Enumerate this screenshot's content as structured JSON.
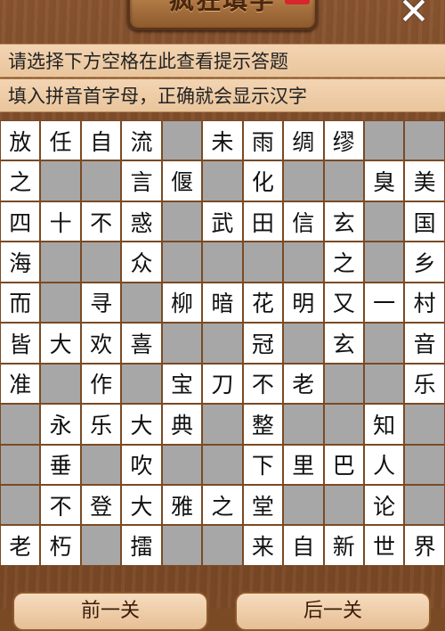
{
  "header": {
    "title": "疯狂填字",
    "close_symbol": "✕"
  },
  "hints": {
    "line1": "请选择下方空格在此查看提示答题",
    "line2": "填入拼音首字母，正确就会显示汉字"
  },
  "grid": [
    [
      {
        "c": "放",
        "t": "f"
      },
      {
        "c": "任",
        "t": "f"
      },
      {
        "c": "自",
        "t": "f"
      },
      {
        "c": "流",
        "t": "f"
      },
      {
        "c": "",
        "t": "e"
      },
      {
        "c": "未",
        "t": "f"
      },
      {
        "c": "雨",
        "t": "f"
      },
      {
        "c": "绸",
        "t": "f"
      },
      {
        "c": "缪",
        "t": "f"
      },
      {
        "c": "",
        "t": "e"
      },
      {
        "c": "",
        "t": "e"
      }
    ],
    [
      {
        "c": "之",
        "t": "f"
      },
      {
        "c": "",
        "t": "e"
      },
      {
        "c": "",
        "t": "e"
      },
      {
        "c": "言",
        "t": "f"
      },
      {
        "c": "偃",
        "t": "f"
      },
      {
        "c": "",
        "t": "e"
      },
      {
        "c": "化",
        "t": "f"
      },
      {
        "c": "",
        "t": "e"
      },
      {
        "c": "",
        "t": "e"
      },
      {
        "c": "臭",
        "t": "f"
      },
      {
        "c": "美",
        "t": "f"
      }
    ],
    [
      {
        "c": "四",
        "t": "f"
      },
      {
        "c": "十",
        "t": "f"
      },
      {
        "c": "不",
        "t": "f"
      },
      {
        "c": "惑",
        "t": "f"
      },
      {
        "c": "",
        "t": "e"
      },
      {
        "c": "武",
        "t": "f"
      },
      {
        "c": "田",
        "t": "f"
      },
      {
        "c": "信",
        "t": "f"
      },
      {
        "c": "玄",
        "t": "f"
      },
      {
        "c": "",
        "t": "e"
      },
      {
        "c": "国",
        "t": "f"
      }
    ],
    [
      {
        "c": "海",
        "t": "f"
      },
      {
        "c": "",
        "t": "e"
      },
      {
        "c": "",
        "t": "e"
      },
      {
        "c": "众",
        "t": "f"
      },
      {
        "c": "",
        "t": "e"
      },
      {
        "c": "",
        "t": "e"
      },
      {
        "c": "",
        "t": "e"
      },
      {
        "c": "",
        "t": "e"
      },
      {
        "c": "之",
        "t": "f"
      },
      {
        "c": "",
        "t": "e"
      },
      {
        "c": "乡",
        "t": "f"
      }
    ],
    [
      {
        "c": "而",
        "t": "f"
      },
      {
        "c": "",
        "t": "e"
      },
      {
        "c": "寻",
        "t": "f"
      },
      {
        "c": "",
        "t": "e"
      },
      {
        "c": "柳",
        "t": "f"
      },
      {
        "c": "暗",
        "t": "f"
      },
      {
        "c": "花",
        "t": "f"
      },
      {
        "c": "明",
        "t": "f"
      },
      {
        "c": "又",
        "t": "f"
      },
      {
        "c": "一",
        "t": "f"
      },
      {
        "c": "村",
        "t": "f"
      }
    ],
    [
      {
        "c": "皆",
        "t": "f"
      },
      {
        "c": "大",
        "t": "f"
      },
      {
        "c": "欢",
        "t": "f"
      },
      {
        "c": "喜",
        "t": "f"
      },
      {
        "c": "",
        "t": "e"
      },
      {
        "c": "",
        "t": "e"
      },
      {
        "c": "冠",
        "t": "f"
      },
      {
        "c": "",
        "t": "e"
      },
      {
        "c": "玄",
        "t": "f"
      },
      {
        "c": "",
        "t": "e"
      },
      {
        "c": "音",
        "t": "f"
      }
    ],
    [
      {
        "c": "准",
        "t": "f"
      },
      {
        "c": "",
        "t": "e"
      },
      {
        "c": "作",
        "t": "f"
      },
      {
        "c": "",
        "t": "e"
      },
      {
        "c": "宝",
        "t": "f"
      },
      {
        "c": "刀",
        "t": "f"
      },
      {
        "c": "不",
        "t": "f"
      },
      {
        "c": "老",
        "t": "f"
      },
      {
        "c": "",
        "t": "e"
      },
      {
        "c": "",
        "t": "e"
      },
      {
        "c": "乐",
        "t": "f"
      }
    ],
    [
      {
        "c": "",
        "t": "e"
      },
      {
        "c": "永",
        "t": "f"
      },
      {
        "c": "乐",
        "t": "f"
      },
      {
        "c": "大",
        "t": "f"
      },
      {
        "c": "典",
        "t": "f"
      },
      {
        "c": "",
        "t": "e"
      },
      {
        "c": "整",
        "t": "f"
      },
      {
        "c": "",
        "t": "e"
      },
      {
        "c": "",
        "t": "e"
      },
      {
        "c": "知",
        "t": "f"
      },
      {
        "c": "",
        "t": "e"
      }
    ],
    [
      {
        "c": "",
        "t": "e"
      },
      {
        "c": "垂",
        "t": "f"
      },
      {
        "c": "",
        "t": "e"
      },
      {
        "c": "吹",
        "t": "f"
      },
      {
        "c": "",
        "t": "e"
      },
      {
        "c": "",
        "t": "e"
      },
      {
        "c": "下",
        "t": "f"
      },
      {
        "c": "里",
        "t": "f"
      },
      {
        "c": "巴",
        "t": "f"
      },
      {
        "c": "人",
        "t": "f"
      },
      {
        "c": "",
        "t": "e"
      }
    ],
    [
      {
        "c": "",
        "t": "e"
      },
      {
        "c": "不",
        "t": "f"
      },
      {
        "c": "登",
        "t": "f"
      },
      {
        "c": "大",
        "t": "f"
      },
      {
        "c": "雅",
        "t": "f"
      },
      {
        "c": "之",
        "t": "f"
      },
      {
        "c": "堂",
        "t": "f"
      },
      {
        "c": "",
        "t": "e"
      },
      {
        "c": "",
        "t": "e"
      },
      {
        "c": "论",
        "t": "f"
      },
      {
        "c": "",
        "t": "e"
      }
    ],
    [
      {
        "c": "老",
        "t": "f"
      },
      {
        "c": "朽",
        "t": "f"
      },
      {
        "c": "",
        "t": "e"
      },
      {
        "c": "擂",
        "t": "f"
      },
      {
        "c": "",
        "t": "e"
      },
      {
        "c": "",
        "t": "e"
      },
      {
        "c": "来",
        "t": "f"
      },
      {
        "c": "自",
        "t": "f"
      },
      {
        "c": "新",
        "t": "f"
      },
      {
        "c": "世",
        "t": "f"
      },
      {
        "c": "界",
        "t": "f"
      }
    ]
  ],
  "footer": {
    "prev_label": "前一关",
    "next_label": "后一关"
  }
}
